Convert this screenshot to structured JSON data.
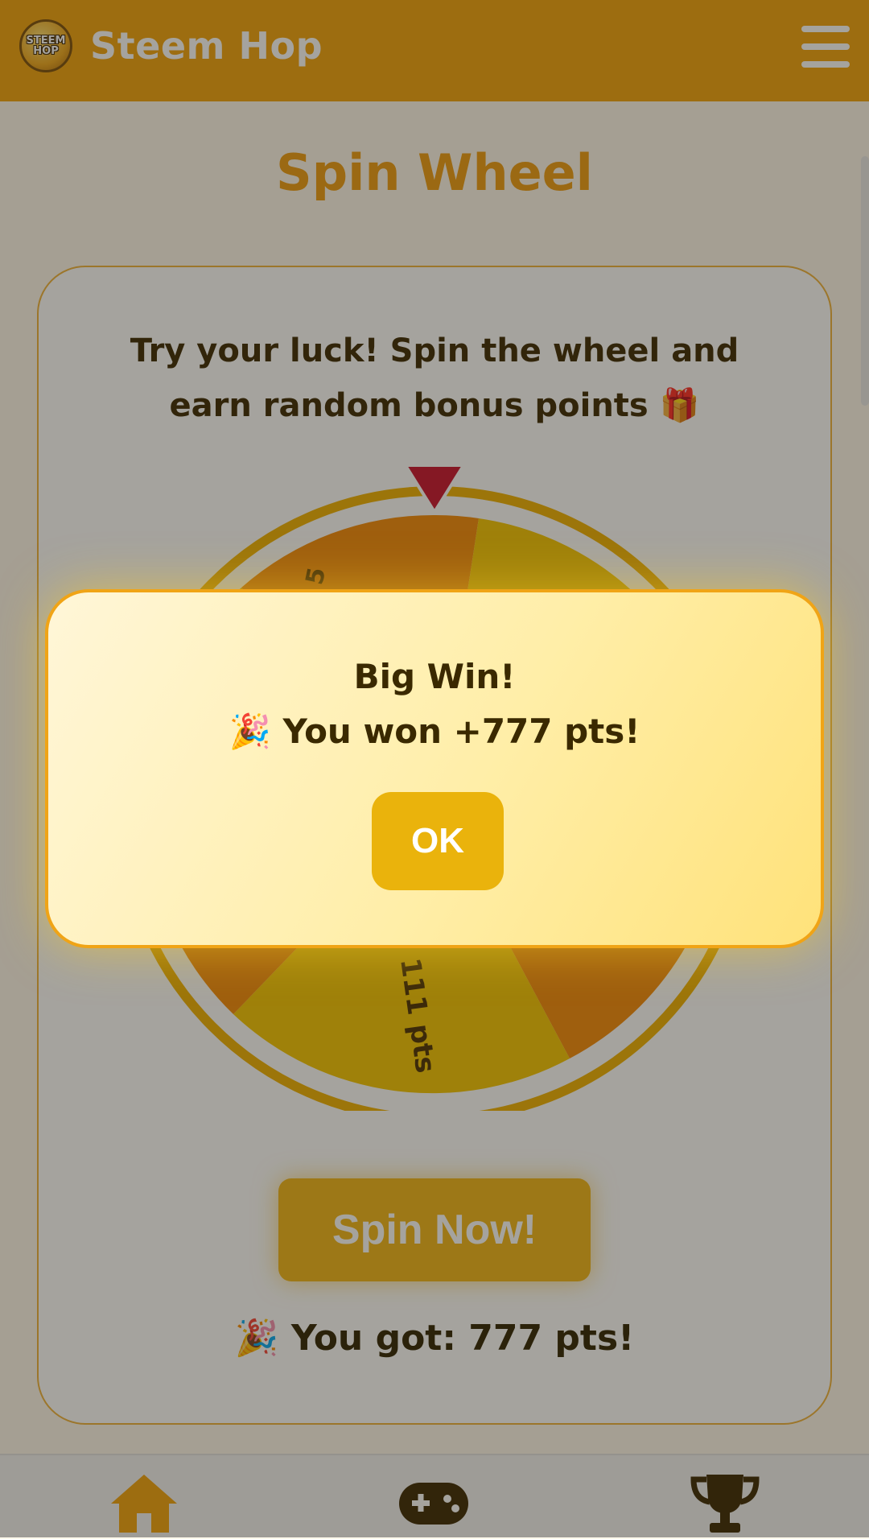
{
  "header": {
    "logo_text": "STEEM\nHOP",
    "app_title": "Steem Hop",
    "menu_icon": "hamburger-menu-icon"
  },
  "page": {
    "title": "Spin Wheel",
    "subtitle": "Try your luck! Spin the wheel and earn random bonus points 🎁"
  },
  "wheel": {
    "visible_segment_labels": [
      "5",
      "111 pts"
    ],
    "pointer_icon": "triangle-pointer-icon",
    "colors": {
      "ring": "#f0b000",
      "orange": "#f58a07",
      "yellow": "#f5c400",
      "pointer": "#c8102e"
    }
  },
  "actions": {
    "spin_label": "Spin Now!",
    "result_text": "🎉 You got: 777 pts!"
  },
  "dialog": {
    "title": "Big Win!",
    "message": "🎉 You won +777 pts!",
    "ok_label": "OK"
  },
  "bottom_nav": {
    "items": [
      {
        "icon": "home-icon"
      },
      {
        "icon": "gamepad-icon"
      },
      {
        "icon": "trophy-icon"
      }
    ]
  },
  "colors": {
    "brand": "#f2a20c",
    "accent_text": "#ee9b10",
    "button": "#f2b617"
  }
}
